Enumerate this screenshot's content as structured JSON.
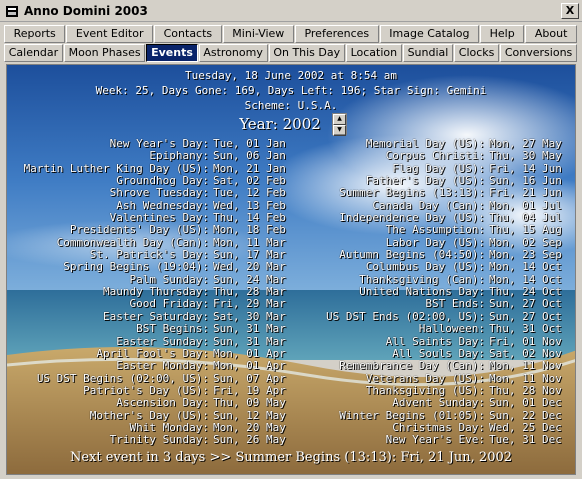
{
  "window": {
    "title": "Anno Domini 2003",
    "close_label": "X"
  },
  "tabs_row1": [
    "Reports",
    "Event Editor",
    "Contacts",
    "Mini-View",
    "Preferences",
    "Image Catalog",
    "Help",
    "About"
  ],
  "tabs_row2": [
    "Calendar",
    "Moon Phases",
    "Events",
    "Astronomy",
    "On This Day",
    "Location",
    "Sundial",
    "Clocks",
    "Conversions"
  ],
  "active_tab": "Events",
  "header": {
    "date_line": "Tuesday, 18 June 2002 at 8:54 am",
    "week_line": "Week: 25, Days Gone: 169, Days Left: 196; Star Sign: Gemini",
    "scheme_line": "Scheme: U.S.A.",
    "year_label": "Year: 2002"
  },
  "events_left": [
    {
      "name": "New Year's Day:",
      "date": "Tue, 01 Jan"
    },
    {
      "name": "Epiphany:",
      "date": "Sun, 06 Jan"
    },
    {
      "name": "Martin Luther King Day (US):",
      "date": "Mon, 21 Jan"
    },
    {
      "name": "Groundhog Day:",
      "date": "Sat, 02 Feb"
    },
    {
      "name": "Shrove Tuesday:",
      "date": "Tue, 12 Feb"
    },
    {
      "name": "Ash Wednesday:",
      "date": "Wed, 13 Feb"
    },
    {
      "name": "Valentines Day:",
      "date": "Thu, 14 Feb"
    },
    {
      "name": "Presidents' Day (US):",
      "date": "Mon, 18 Feb"
    },
    {
      "name": "Commonwealth Day (Can):",
      "date": "Mon, 11 Mar"
    },
    {
      "name": "St. Patrick's Day:",
      "date": "Sun, 17 Mar"
    },
    {
      "name": "Spring Begins (19:04):",
      "date": "Wed, 20 Mar"
    },
    {
      "name": "Palm Sunday:",
      "date": "Sun, 24 Mar"
    },
    {
      "name": "Maundy Thursday:",
      "date": "Thu, 28 Mar"
    },
    {
      "name": "Good Friday:",
      "date": "Fri, 29 Mar"
    },
    {
      "name": "Easter Saturday:",
      "date": "Sat, 30 Mar"
    },
    {
      "name": "BST Begins:",
      "date": "Sun, 31 Mar"
    },
    {
      "name": "Easter Sunday:",
      "date": "Sun, 31 Mar"
    },
    {
      "name": "April Fool's Day:",
      "date": "Mon, 01 Apr"
    },
    {
      "name": "Easter Monday:",
      "date": "Mon, 01 Apr"
    },
    {
      "name": "US DST Begins (02:00, US):",
      "date": "Sun, 07 Apr"
    },
    {
      "name": "Patriot's Day (US):",
      "date": "Fri, 19 Apr"
    },
    {
      "name": "Ascension Day:",
      "date": "Thu, 09 May"
    },
    {
      "name": "Mother's Day (US):",
      "date": "Sun, 12 May"
    },
    {
      "name": "Whit Monday:",
      "date": "Mon, 20 May"
    },
    {
      "name": "Trinity Sunday:",
      "date": "Sun, 26 May"
    }
  ],
  "events_right": [
    {
      "name": "Memorial Day (US):",
      "date": "Mon, 27 May"
    },
    {
      "name": "Corpus Christi:",
      "date": "Thu, 30 May"
    },
    {
      "name": "Flag Day (US):",
      "date": "Fri, 14 Jun"
    },
    {
      "name": "Father's Day (US):",
      "date": "Sun, 16 Jun"
    },
    {
      "name": "Summer Begins (13:13):",
      "date": "Fri, 21 Jun"
    },
    {
      "name": "Canada Day (Can):",
      "date": "Mon, 01 Jul"
    },
    {
      "name": "Independence Day (US):",
      "date": "Thu, 04 Jul"
    },
    {
      "name": "The Assumption:",
      "date": "Thu, 15 Aug"
    },
    {
      "name": "Labor Day (US):",
      "date": "Mon, 02 Sep"
    },
    {
      "name": "Autumn Begins (04:50):",
      "date": "Mon, 23 Sep"
    },
    {
      "name": "Columbus Day (US):",
      "date": "Mon, 14 Oct"
    },
    {
      "name": "Thanksgiving (Can):",
      "date": "Mon, 14 Oct"
    },
    {
      "name": "United Nations Day:",
      "date": "Thu, 24 Oct"
    },
    {
      "name": "BST Ends:",
      "date": "Sun, 27 Oct"
    },
    {
      "name": "US DST Ends (02:00, US):",
      "date": "Sun, 27 Oct"
    },
    {
      "name": "Halloween:",
      "date": "Thu, 31 Oct"
    },
    {
      "name": "All Saints Day:",
      "date": "Fri, 01 Nov"
    },
    {
      "name": "All Souls Day:",
      "date": "Sat, 02 Nov"
    },
    {
      "name": "Remembrance Day (Can):",
      "date": "Mon, 11 Nov"
    },
    {
      "name": "Veterans Day (US):",
      "date": "Mon, 11 Nov"
    },
    {
      "name": "Thanksgiving (US):",
      "date": "Thu, 28 Nov"
    },
    {
      "name": "Advent Sunday:",
      "date": "Sun, 01 Dec"
    },
    {
      "name": "Winter Begins (01:05):",
      "date": "Sun, 22 Dec"
    },
    {
      "name": "Christmas Day:",
      "date": "Wed, 25 Dec"
    },
    {
      "name": "New Year's Eve:",
      "date": "Tue, 31 Dec"
    }
  ],
  "footer": {
    "next_event": "Next event in 3 days >> Summer Begins (13:13): Fri, 21 Jun, 2002"
  },
  "icons": {
    "app": "hourglass-icon",
    "spin_up": "arrow-up-icon",
    "spin_down": "arrow-down-icon"
  },
  "colors": {
    "active_tab_bg": "#0a246a",
    "chrome": "#d4d0c8",
    "text_on_image": "#ffffff"
  }
}
